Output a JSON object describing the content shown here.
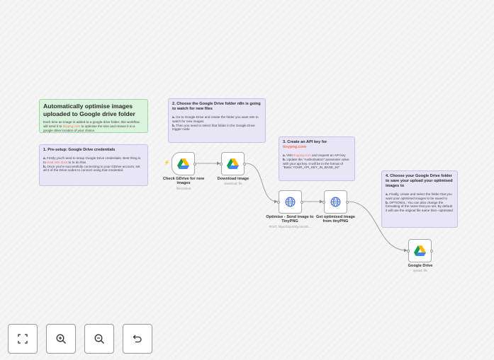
{
  "notes": {
    "title": {
      "heading": "Automatically optimise images uploaded to Google drive folder",
      "body_pre": "Each time an image is added to a google drive folder, this workflow will send it to ",
      "body_link": "tinypng.com",
      "body_post": " to optimise the size and resave it to a google drive location of your choice."
    },
    "step1": {
      "heading": "1. Pre-setup: Google Drive credentials",
      "a_letter": "a.",
      "a_pre": " Firstly you'll need to setup Google Drive credentials. Best thing is to ",
      "a_link": "read n8n docs",
      "a_post": " to to do that.",
      "b_letter": "b.",
      "b_text": " Once you're successfully connecting to your GDrive account, set all 3 of the Drive nodes to connect using that credential."
    },
    "step2": {
      "heading": "2. Choose the Google Drive folder n8n is going to watch for new files",
      "a_letter": "a.",
      "a_text": " Go to Google Drive and create the folder you want n8n to watch for new images",
      "b_letter": "b.",
      "b_text": " Then you need to select that folder in the Google Drive trigger node"
    },
    "step3": {
      "heading_pre": "3. Create an API key for ",
      "heading_link": "tinypng.com",
      "a_letter": "a.",
      "a_pre": " Visit ",
      "a_link": "tinypng.com",
      "a_post": " and request an API key",
      "b_letter": "b.",
      "b_text": " Update the \"Authorisation\" parameter value with your api key. It will be in the format of \"Basic YOUR_API_KEY_IN_BASE_64\""
    },
    "step4": {
      "heading": "4. Choose your Google Drive folder to save your upload your optimised images to",
      "a_letter": "a.",
      "a_text": " Finally, create and select the folder that you want your optimised images to be saved to",
      "b_letter": "b.",
      "b_text": " OPTIONAL: You can also change the formatting of the name that you set. By default it will use the original file name then -optimised"
    }
  },
  "nodes": {
    "check_gdrive": {
      "label": "Check GDrive for new images",
      "sub": "fileCreated",
      "icon": "google-drive-icon"
    },
    "download_image": {
      "label": "Download image",
      "sub": "download: file",
      "icon": "google-drive-icon"
    },
    "optimise": {
      "label": "Optimise - Send image to TinyPNG",
      "sub": "POST: https://api.tinify.com/sh...",
      "icon": "globe-icon"
    },
    "get_optimised": {
      "label": "Get optimised image from tinyPNG",
      "sub": "",
      "icon": "globe-icon"
    },
    "google_drive": {
      "label": "Google Drive",
      "sub": "upload: file",
      "icon": "google-drive-icon"
    }
  },
  "controls": [
    {
      "name": "fit-view-button",
      "icon": "fit-view-icon"
    },
    {
      "name": "zoom-in-button",
      "icon": "zoom-in-icon"
    },
    {
      "name": "zoom-out-button",
      "icon": "zoom-out-icon"
    },
    {
      "name": "reset-zoom-button",
      "icon": "undo-icon"
    }
  ],
  "colors": {
    "accent": "#ff6d5a",
    "sticky_green": "#d9f3dd",
    "sticky_purple": "#e7e5f6",
    "globe": "#4a6fd6",
    "edge": "#8a8a8a"
  }
}
